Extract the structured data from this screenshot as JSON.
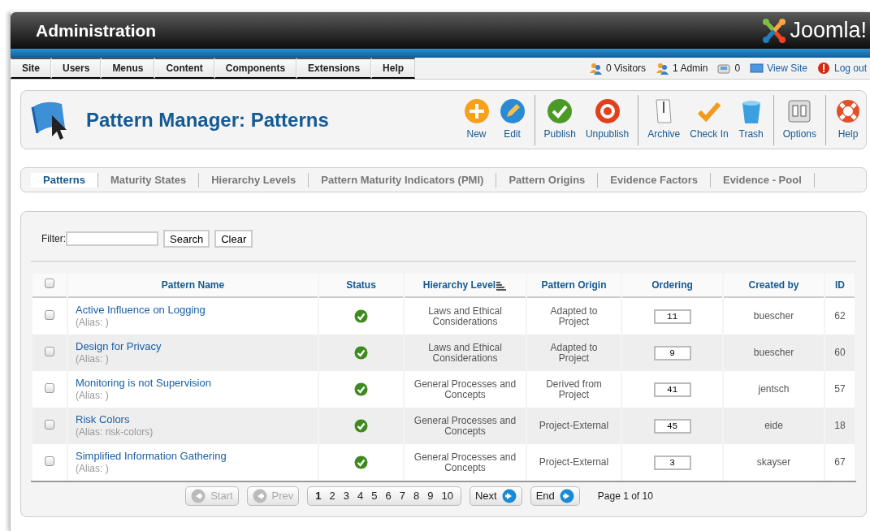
{
  "header": {
    "title": "Administration",
    "logo": "Joomla!"
  },
  "menu": [
    {
      "label": "Site"
    },
    {
      "label": "Users"
    },
    {
      "label": "Menus"
    },
    {
      "label": "Content"
    },
    {
      "label": "Components"
    },
    {
      "label": "Extensions"
    },
    {
      "label": "Help"
    }
  ],
  "status": [
    {
      "kind": "visitors",
      "label": "0 Visitors"
    },
    {
      "kind": "admin",
      "label": "1 Admin"
    },
    {
      "kind": "messages",
      "label": "0"
    },
    {
      "kind": "view",
      "label": "View Site"
    },
    {
      "kind": "logout",
      "label": "Log out"
    }
  ],
  "toolbar": {
    "title": "Pattern Manager: Patterns",
    "buttons": [
      {
        "kind": "new",
        "label": "New",
        "separator_before": false
      },
      {
        "kind": "edit",
        "label": "Edit",
        "separator_before": false
      },
      {
        "kind": "publish",
        "label": "Publish",
        "separator_before": true
      },
      {
        "kind": "unpublish",
        "label": "Unpublish",
        "separator_before": false
      },
      {
        "kind": "archive",
        "label": "Archive",
        "separator_before": true
      },
      {
        "kind": "checkin",
        "label": "Check In",
        "separator_before": false
      },
      {
        "kind": "trash",
        "label": "Trash",
        "separator_before": false
      },
      {
        "kind": "options",
        "label": "Options",
        "separator_before": true
      },
      {
        "kind": "help",
        "label": "Help",
        "separator_before": true
      }
    ]
  },
  "submenu": [
    {
      "label": "Patterns",
      "selected": true
    },
    {
      "label": "Maturity States",
      "selected": false
    },
    {
      "label": "Hierarchy Levels",
      "selected": false
    },
    {
      "label": "Pattern Maturity Indicators (PMI)",
      "selected": false
    },
    {
      "label": "Pattern Origins",
      "selected": false
    },
    {
      "label": "Evidence Factors",
      "selected": false
    },
    {
      "label": "Evidence - Pool",
      "selected": false
    }
  ],
  "filter": {
    "label": "Filter:",
    "buttons": [
      "Search",
      "Clear"
    ]
  },
  "table": {
    "select_all": {
      "checked": false
    },
    "columns": [
      {
        "label": "Pattern Name",
        "sorted": false
      },
      {
        "label": "Status",
        "sorted": false
      },
      {
        "label": "Hierarchy Level",
        "sorted": true
      },
      {
        "label": "Pattern Origin",
        "sorted": false
      },
      {
        "label": "Ordering",
        "sorted": false
      },
      {
        "label": "Created by",
        "sorted": false
      },
      {
        "label": "ID",
        "sorted": false
      }
    ],
    "rows": [
      {
        "checked": false,
        "name": "Active Influence on Logging",
        "alias": "(Alias: )",
        "published": true,
        "level": "Laws and Ethical Considerations",
        "origin": "Adapted to Project",
        "ordering": "11",
        "created_by": "buescher",
        "id": "62"
      },
      {
        "checked": false,
        "name": "Design for Privacy",
        "alias": "(Alias: )",
        "published": true,
        "level": "Laws and Ethical Considerations",
        "origin": "Adapted to Project",
        "ordering": "9",
        "created_by": "buescher",
        "id": "60"
      },
      {
        "checked": false,
        "name": "Monitoring is not Supervision",
        "alias": "(Alias: )",
        "published": true,
        "level": "General Processes and Concepts",
        "origin": "Derived from Project",
        "ordering": "41",
        "created_by": "jentsch",
        "id": "57"
      },
      {
        "checked": false,
        "name": "Risk Colors",
        "alias": "(Alias: risk-colors)",
        "published": true,
        "level": "General Processes and Concepts",
        "origin": "Project-External",
        "ordering": "45",
        "created_by": "eide",
        "id": "18"
      },
      {
        "checked": false,
        "name": "Simplified Information Gathering",
        "alias": "(Alias: )",
        "published": true,
        "level": "General Processes and Concepts",
        "origin": "Project-External",
        "ordering": "3",
        "created_by": "skayser",
        "id": "67"
      }
    ]
  },
  "pagination": {
    "start": {
      "label": "Start",
      "disabled": true
    },
    "prev": {
      "label": "Prev",
      "disabled": true
    },
    "pages": [
      {
        "label": "1",
        "selected": true
      },
      {
        "label": "2",
        "selected": false
      },
      {
        "label": "3",
        "selected": false
      },
      {
        "label": "4",
        "selected": false
      },
      {
        "label": "5",
        "selected": false
      },
      {
        "label": "6",
        "selected": false
      },
      {
        "label": "7",
        "selected": false
      },
      {
        "label": "8",
        "selected": false
      },
      {
        "label": "9",
        "selected": false
      },
      {
        "label": "10",
        "selected": false
      }
    ],
    "next": {
      "label": "Next",
      "disabled": false
    },
    "end": {
      "label": "End",
      "disabled": false
    },
    "info": "Page 1 of 10"
  }
}
